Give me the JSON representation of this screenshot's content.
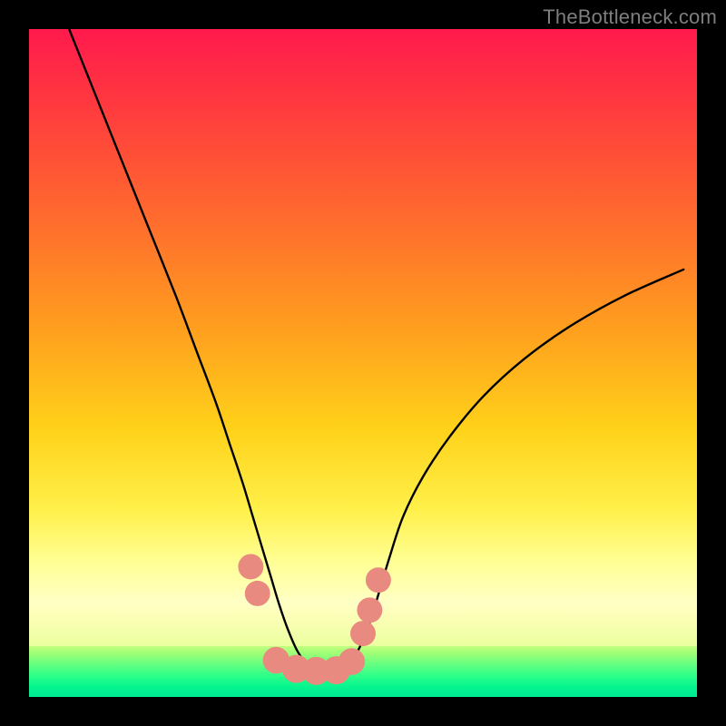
{
  "watermark": "TheBottleneck.com",
  "chart_data": {
    "type": "line",
    "title": "",
    "xlabel": "",
    "ylabel": "",
    "xlim": [
      0,
      100
    ],
    "ylim": [
      0,
      100
    ],
    "grid": false,
    "legend": false,
    "series": [
      {
        "name": "left-branch",
        "x": [
          6,
          10,
          14,
          18,
          22,
          25,
          28,
          30,
          32,
          33.5,
          35,
          36.2,
          37.4,
          38.8,
          40.4,
          42.5,
          46
        ],
        "y": [
          100,
          90,
          80,
          70,
          60,
          52,
          44,
          38,
          32,
          27,
          22,
          18,
          14,
          10,
          6.5,
          4.2,
          3.8
        ]
      },
      {
        "name": "right-branch",
        "x": [
          46,
          47.5,
          49,
          50.2,
          51.3,
          52.5,
          54,
          56,
          59,
          63,
          68,
          74,
          81,
          89,
          98
        ],
        "y": [
          3.8,
          4.6,
          6.5,
          9,
          12,
          16,
          21,
          27,
          33,
          39,
          45,
          50.5,
          55.5,
          60,
          64
        ]
      }
    ],
    "markers": [
      {
        "name": "marker-left-upper",
        "x": 33.2,
        "y": 19.5,
        "r": 1.9
      },
      {
        "name": "marker-left-lower",
        "x": 34.2,
        "y": 15.5,
        "r": 1.9
      },
      {
        "name": "marker-bottom-a",
        "x": 37.0,
        "y": 5.5,
        "r": 2.0
      },
      {
        "name": "marker-bottom-b",
        "x": 40.0,
        "y": 4.2,
        "r": 2.1
      },
      {
        "name": "marker-bottom-c",
        "x": 43.0,
        "y": 3.9,
        "r": 2.1
      },
      {
        "name": "marker-bottom-d",
        "x": 46.0,
        "y": 4.0,
        "r": 2.1
      },
      {
        "name": "marker-bottom-e",
        "x": 48.3,
        "y": 5.3,
        "r": 2.0
      },
      {
        "name": "marker-right-lower",
        "x": 50.0,
        "y": 9.5,
        "r": 1.9
      },
      {
        "name": "marker-right-mid",
        "x": 51.0,
        "y": 13.0,
        "r": 1.9
      },
      {
        "name": "marker-right-upper",
        "x": 52.3,
        "y": 17.5,
        "r": 1.9
      }
    ],
    "marker_color": "#e88a7f",
    "curve_color": "#000000",
    "curve_width": 2.4,
    "thick_bottom": {
      "color": "#e88a7f",
      "width": 14,
      "x": [
        36.5,
        38.5,
        41,
        44,
        46.5,
        48.5
      ],
      "y": [
        6.0,
        4.7,
        4.0,
        4.0,
        4.8,
        6.0
      ]
    }
  }
}
